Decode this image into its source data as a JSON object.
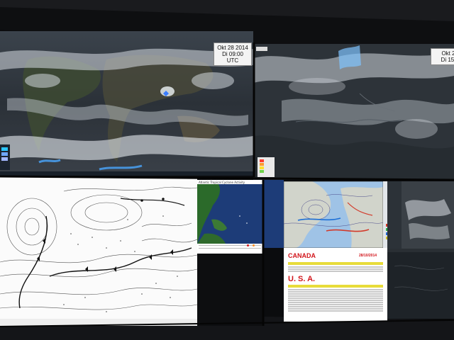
{
  "top_left_panel": {
    "date": "Okt 28 2014",
    "time": "Di 09:00 UTC"
  },
  "top_right_panel": {
    "date": "Okt 2",
    "time": "Di 15:"
  },
  "inset_map": {
    "title": "Atlantic Tropical Cyclone Activity"
  },
  "report": {
    "canada_title": "CANADA",
    "report_date": "28/10/2014",
    "usa_title": "U. S. A."
  },
  "colors": {
    "report_red": "#d2161c",
    "band_yellow": "#e8dc3a",
    "satellite_dark": "#2a3036",
    "ocean_blue": "#1d3c78"
  }
}
